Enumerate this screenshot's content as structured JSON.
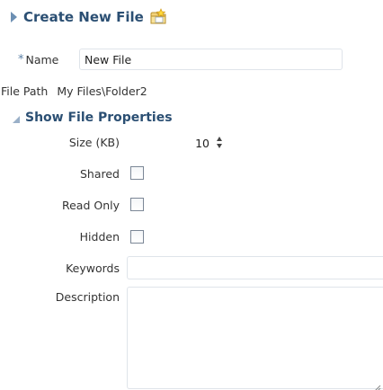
{
  "header": {
    "title": "Create New File",
    "icon": "folder-new-icon"
  },
  "form": {
    "name": {
      "required_mark": "*",
      "label": "Name",
      "value": "New File"
    },
    "file_path": {
      "label": "File Path",
      "value": "My Files\\Folder2"
    },
    "properties_section": {
      "label": "Show File Properties",
      "expanded": true
    },
    "size": {
      "label": "Size (KB)",
      "value": "10"
    },
    "shared": {
      "label": "Shared",
      "checked": false
    },
    "read_only": {
      "label": "Read Only",
      "checked": false
    },
    "hidden": {
      "label": "Hidden",
      "checked": false
    },
    "keywords": {
      "label": "Keywords",
      "value": ""
    },
    "description": {
      "label": "Description",
      "value": ""
    }
  },
  "colors": {
    "title": "#2b4f73",
    "required": "#5a7fa5",
    "field_border": "#dfe4ea",
    "checkbox_border": "#7b8796"
  }
}
